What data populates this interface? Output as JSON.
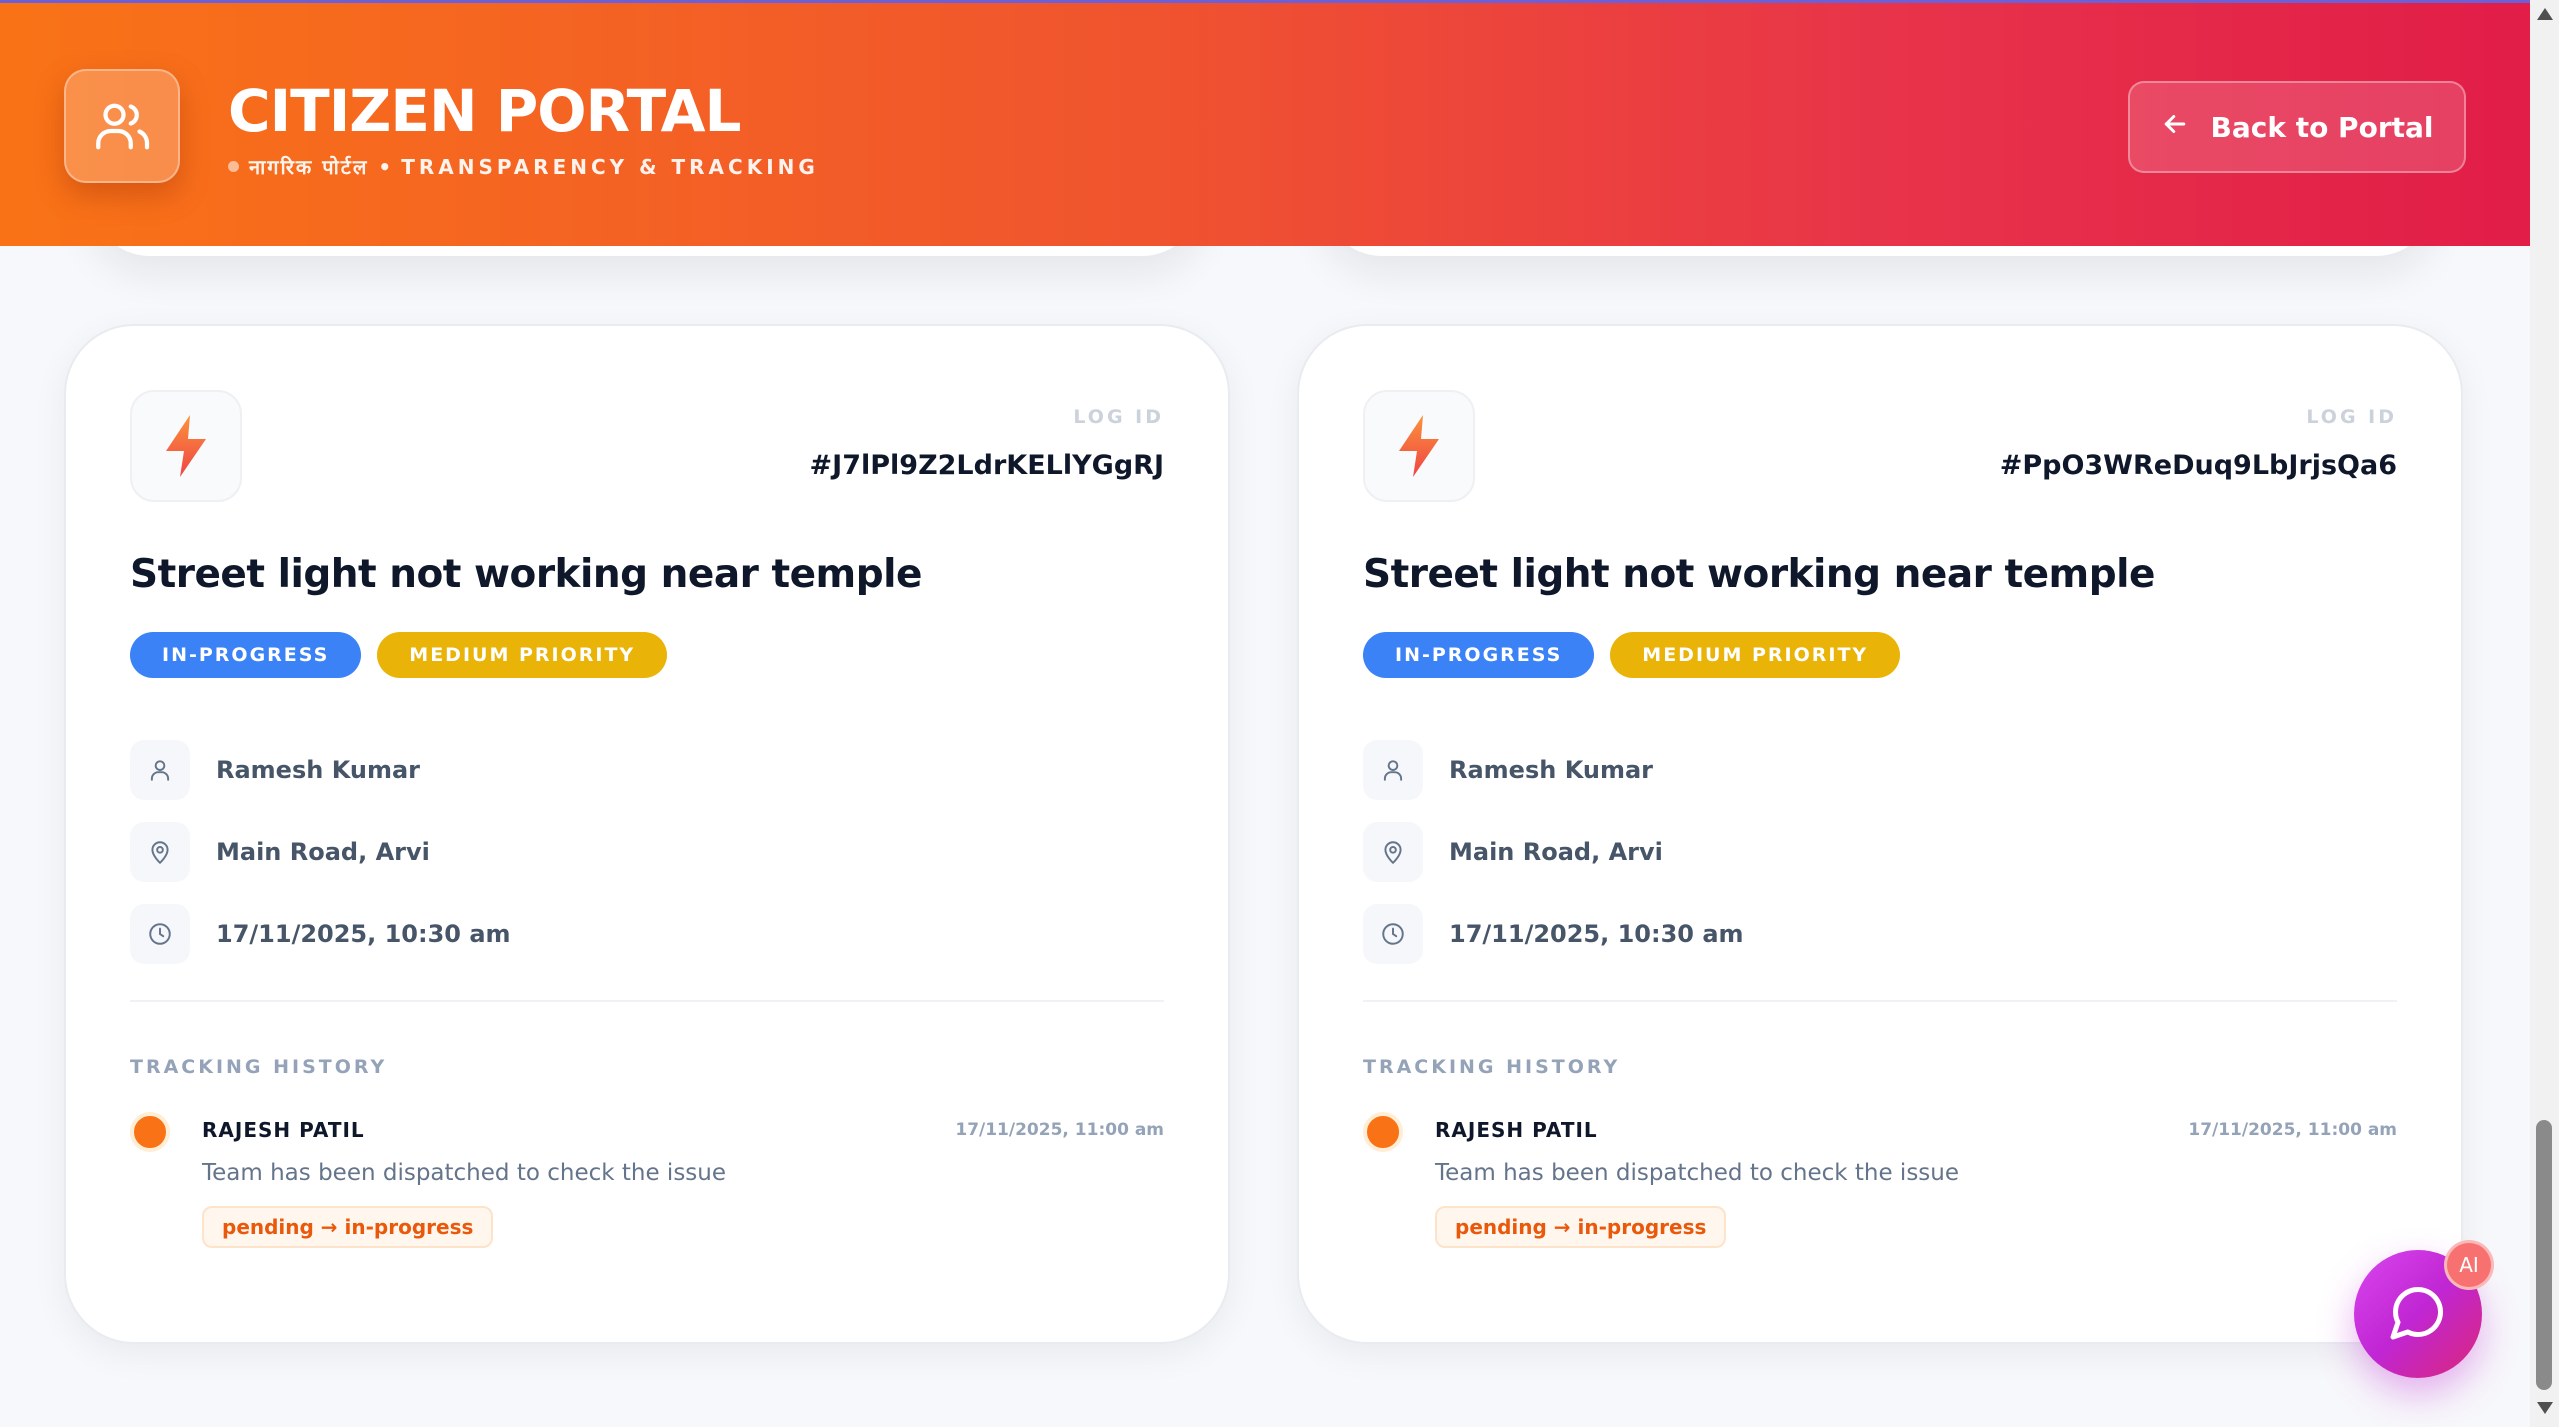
{
  "header": {
    "title": "CITIZEN PORTAL",
    "subtitle_hindi": "नागरिक पोर्टल",
    "subtitle_bullet": "•",
    "subtitle_en": "TRANSPARENCY & TRACKING",
    "back_label": "Back to Portal",
    "icon": "users-icon"
  },
  "cards": [
    {
      "icon": "lightning-bolt-icon",
      "log_label": "LOG ID",
      "log_id": "#J7lPl9Z2LdrKELlYGgRJ",
      "title": "Street light not working near temple",
      "status": "IN-PROGRESS",
      "priority": "MEDIUM PRIORITY",
      "reporter": "Ramesh Kumar",
      "location": "Main Road, Arvi",
      "datetime": "17/11/2025, 10:30 am",
      "tracking_label": "TRACKING HISTORY",
      "history": [
        {
          "author": "RAJESH PATIL",
          "time": "17/11/2025, 11:00 am",
          "message": "Team has been dispatched to check the issue",
          "change": "pending → in-progress"
        }
      ]
    },
    {
      "icon": "lightning-bolt-icon",
      "log_label": "LOG ID",
      "log_id": "#PpO3WReDuq9LbJrjsQa6",
      "title": "Street light not working near temple",
      "status": "IN-PROGRESS",
      "priority": "MEDIUM PRIORITY",
      "reporter": "Ramesh Kumar",
      "location": "Main Road, Arvi",
      "datetime": "17/11/2025, 10:30 am",
      "tracking_label": "TRACKING HISTORY",
      "history": [
        {
          "author": "RAJESH PATIL",
          "time": "17/11/2025, 11:00 am",
          "message": "Team has been dispatched to check the issue",
          "change": "pending → in-progress"
        }
      ]
    }
  ],
  "chat": {
    "badge": "AI",
    "icon": "chat-bubble-icon"
  },
  "colors": {
    "header_start": "#f97316",
    "header_end": "#e11d48",
    "status_badge": "#3b82f6",
    "priority_badge": "#eab308",
    "timeline_dot": "#f97316",
    "chat_fab": "#c026d3"
  }
}
